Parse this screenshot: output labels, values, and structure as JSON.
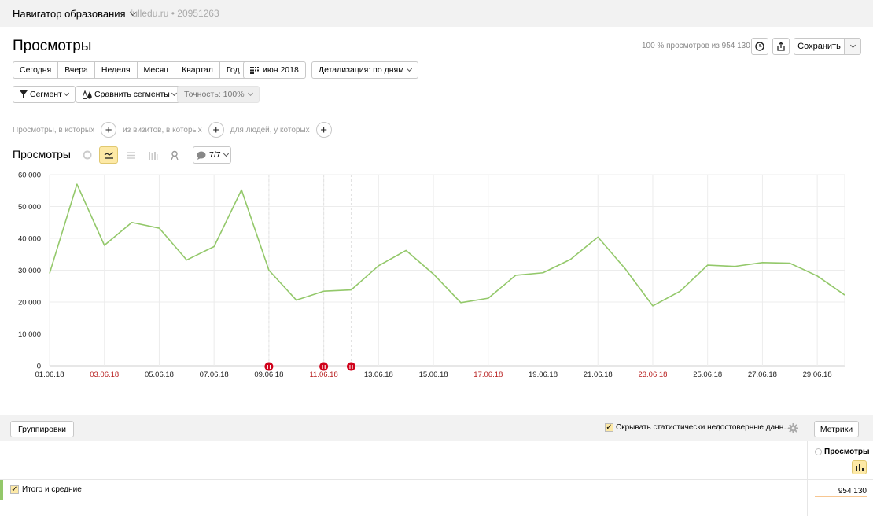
{
  "header": {
    "app_title": "Навигатор образования",
    "site": "fulledu.ru",
    "separator": "•",
    "counter_id": "20951263"
  },
  "report": {
    "title": "Просмотры",
    "share_info": "100 % просмотров из 954 130",
    "save_label": "Сохранить",
    "icons": [
      "clock-icon",
      "export-icon",
      "chevron-down-icon"
    ]
  },
  "period": {
    "buttons": [
      "Сегодня",
      "Вчера",
      "Неделя",
      "Месяц",
      "Квартал",
      "Год"
    ],
    "date_label": "июн 2018",
    "detail_label": "Детализация: по дням"
  },
  "filters": {
    "segment_label": "Сегмент",
    "compare_label": "Сравнить сегменты",
    "accuracy_label": "Точность: 100%"
  },
  "segment_builder": {
    "pageviews_label": "Просмотры, в которых",
    "visits_label": "из визитов, в которых",
    "people_label": "для людей, у которых"
  },
  "chart_section": {
    "title": "Просмотры",
    "notes_label": "7/7",
    "view_icons": [
      "pie-chart-icon",
      "line-chart-icon",
      "area-chart-icon",
      "bar-chart-icon",
      "map-icon"
    ]
  },
  "chart_data": {
    "type": "line",
    "x": [
      "01.06.18",
      "02.06.18",
      "03.06.18",
      "04.06.18",
      "05.06.18",
      "06.06.18",
      "07.06.18",
      "08.06.18",
      "09.06.18",
      "10.06.18",
      "11.06.18",
      "12.06.18",
      "13.06.18",
      "14.06.18",
      "15.06.18",
      "16.06.18",
      "17.06.18",
      "18.06.18",
      "19.06.18",
      "20.06.18",
      "21.06.18",
      "22.06.18",
      "23.06.18",
      "24.06.18",
      "25.06.18",
      "26.06.18",
      "27.06.18",
      "28.06.18",
      "29.06.18",
      "30.06.18"
    ],
    "series": [
      {
        "values": [
          29000,
          57000,
          37800,
          45000,
          43200,
          33200,
          37400,
          55200,
          30000,
          20600,
          23400,
          23800,
          31400,
          36200,
          28800,
          19800,
          21200,
          28400,
          29200,
          33400,
          40400,
          30400,
          18800,
          23400,
          31600,
          31200,
          32400,
          32200,
          28200,
          22200
        ]
      }
    ],
    "x_tick_labels": [
      "01.06.18",
      "03.06.18",
      "05.06.18",
      "07.06.18",
      "09.06.18",
      "11.06.18",
      "13.06.18",
      "15.06.18",
      "17.06.18",
      "19.06.18",
      "21.06.18",
      "23.06.18",
      "25.06.18",
      "27.06.18",
      "29.06.18"
    ],
    "weekend_ticks": [
      "03.06.18",
      "11.06.18",
      "17.06.18",
      "23.06.18"
    ],
    "y_ticks": [
      "0",
      "10 000",
      "20 000",
      "30 000",
      "40 000",
      "50 000",
      "60 000"
    ],
    "ylim": [
      0,
      60000
    ],
    "grid": true,
    "notes": [
      {
        "date": "09.06.18",
        "text": "Н"
      },
      {
        "date": "11.06.18",
        "text": "Н"
      },
      {
        "date": "12.06.18",
        "text": "Н"
      }
    ],
    "line_color": "#93c86a",
    "note_color": "#d0021b",
    "weekend_color": "#b71c1c"
  },
  "table": {
    "groupings_label": "Группировки",
    "hide_unreliable_label": "Скрывать статистически недостоверные данн…",
    "metrics_label": "Метрики",
    "column_header": "Просмотры",
    "total_label": "Итого и средние",
    "total_value": "954 130",
    "check_mark": "✓"
  }
}
